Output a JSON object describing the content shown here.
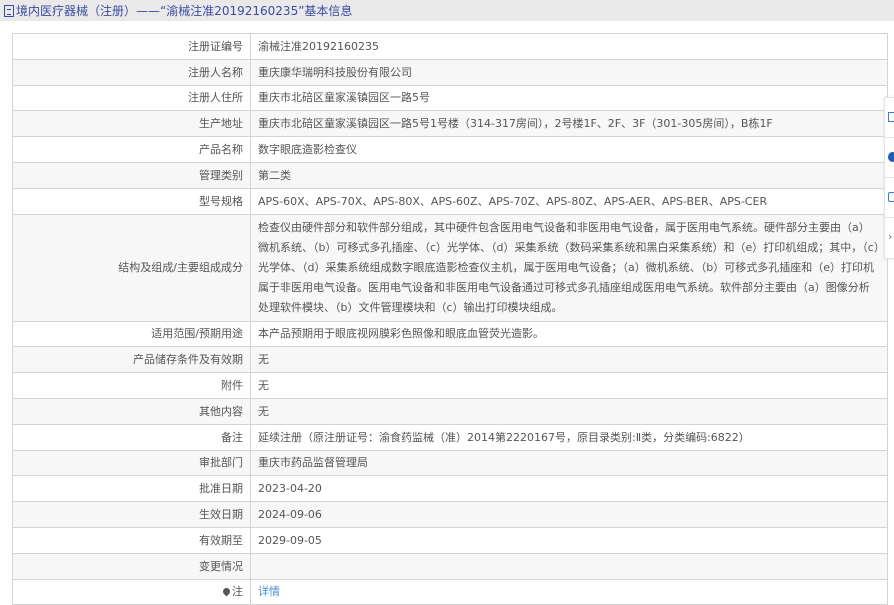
{
  "header": {
    "title": "境内医疗器械（注册）——“渝械注准20192160235”基本信息"
  },
  "rows": [
    {
      "label": "注册证编号",
      "value": "渝械注准20192160235"
    },
    {
      "label": "注册人名称",
      "value": "重庆康华瑞明科技股份有限公司"
    },
    {
      "label": "注册人住所",
      "value": "重庆市北碚区童家溪镇园区一路5号"
    },
    {
      "label": "生产地址",
      "value": "重庆市北碚区童家溪镇园区一路5号1号楼（314-317房间），2号楼1F、2F、3F（301-305房间），B栋1F"
    },
    {
      "label": "产品名称",
      "value": "数字眼底造影检查仪"
    },
    {
      "label": "管理类别",
      "value": "第二类"
    },
    {
      "label": "型号规格",
      "value": "APS-60X、APS-70X、APS-80X、APS-60Z、APS-70Z、APS-80Z、APS-AER、APS-BER、APS-CER"
    },
    {
      "label": "结构及组成/主要组成成分",
      "value": "检查仪由硬件部分和软件部分组成，其中硬件包含医用电气设备和非医用电气设备，属于医用电气系统。硬件部分主要由（a）微机系统、（b）可移式多孔插座、（c）光学体、（d）采集系统（数码采集系统和黑白采集系统）和（e）打印机组成；其中，（c）光学体、（d）采集系统组成数字眼底造影检查仪主机，属于医用电气设备；（a）微机系统、（b）可移式多孔插座和（e）打印机属于非医用电气设备。医用电气设备和非医用电气设备通过可移式多孔插座组成医用电气系统。软件部分主要由（a）图像分析处理软件模块、（b）文件管理模块和（c）输出打印模块组成。"
    },
    {
      "label": "适用范围/预期用途",
      "value": "本产品预期用于眼底视网膜彩色照像和眼底血管荧光造影。"
    },
    {
      "label": "产品储存条件及有效期",
      "value": "无"
    },
    {
      "label": "附件",
      "value": "无"
    },
    {
      "label": "其他内容",
      "value": "无"
    },
    {
      "label": "备注",
      "value": "延续注册（原注册证号：渝食药监械（准）2014第2220167号，原目录类别:Ⅱ类，分类编码:6822）"
    },
    {
      "label": "审批部门",
      "value": "重庆市药品监督管理局"
    },
    {
      "label": "批准日期",
      "value": "2023-04-20"
    },
    {
      "label": "生效日期",
      "value": "2024-09-06"
    },
    {
      "label": "有效期至",
      "value": "2029-09-05"
    },
    {
      "label": "变更情况",
      "value": ""
    }
  ],
  "note": {
    "label": "注",
    "link": "详情"
  }
}
